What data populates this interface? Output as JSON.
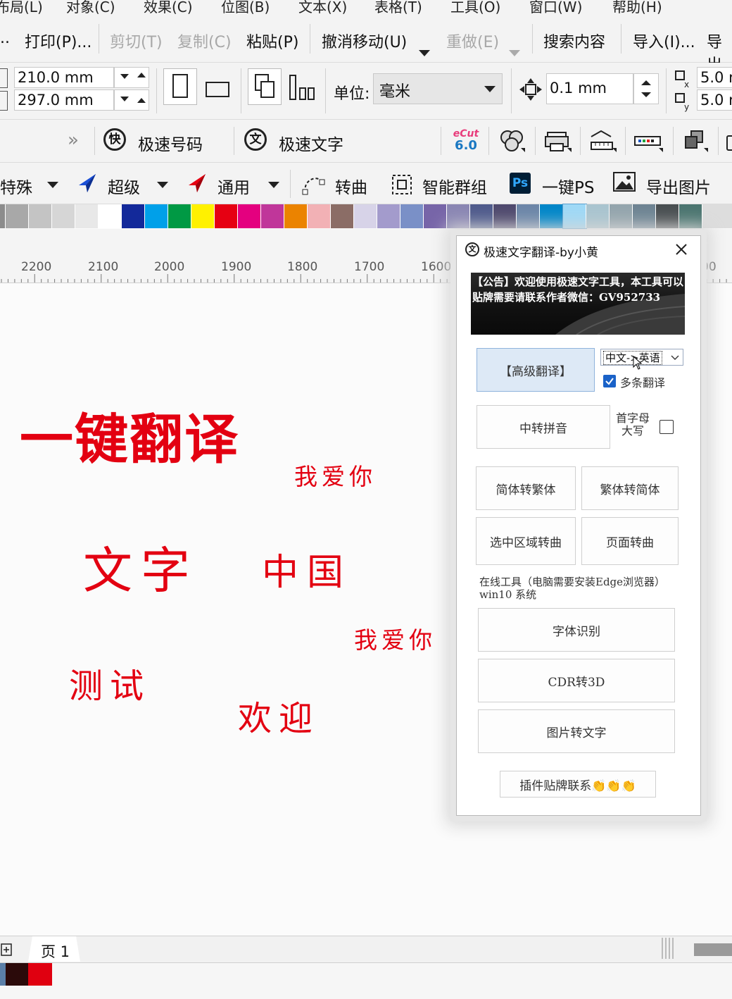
{
  "menu": [
    "布局(L)",
    "对象(C)",
    "效果(C)",
    "位图(B)",
    "文本(X)",
    "表格(T)",
    "工具(O)",
    "窗口(W)",
    "帮助(H)"
  ],
  "toolbar1": {
    "ellipsis": "..",
    "print": "打印(P)...",
    "cut": "剪切(T)",
    "copy": "复制(C)",
    "paste": "粘贴(P)",
    "undo": "撤消移动(U)",
    "redo": "重做(E)",
    "search": "搜索内容",
    "import": "导入(I)...",
    "export": "导出"
  },
  "toolbar2": {
    "width_value": "210.0 mm",
    "height_value": "297.0 mm",
    "unit_label": "单位:",
    "unit_value": "毫米",
    "nudge_value": "0.1 mm",
    "dup_x": "5.0 r",
    "dup_y": "5.0 r"
  },
  "toolbar3": {
    "chevron": "»",
    "fast_number_label": "极速号码",
    "fast_number_icon": "快",
    "fast_text_label": "极速文字",
    "fast_text_icon": "文",
    "ecut_top": "eCut",
    "ecut_bottom": "6.0"
  },
  "toolbar4": {
    "special": "特殊",
    "super": "超级",
    "general": "通用",
    "to_curve": "转曲",
    "smart_group": "智能群组",
    "ps_icon": "Ps",
    "one_key_ps": "一键PS",
    "export_image": "导出图片"
  },
  "palette": [
    "#8c8c8c",
    "#a8a8a8",
    "#c4c4c4",
    "#d6d6d6",
    "#e8e8e8",
    "#ffffff",
    "#13299a",
    "#00a0e9",
    "#009944",
    "#fff100",
    "#e60012",
    "#e4007f",
    "#c0369a",
    "#eb8300",
    "#f2b1b5",
    "#8b6d66",
    "#d7d3e8",
    "#a39bcc",
    "#7a90c7",
    "#7765a8",
    "#8a86b3",
    "#4f5b8c",
    "#4f4a6e",
    "#6c86a8",
    "#0086c8",
    "#9fd9f6",
    "#a9c4cf",
    "#94a5ad",
    "#6e8493",
    "#4a4f52",
    "#4b7570"
  ],
  "ruler": [
    "2200",
    "2100",
    "2000",
    "1900",
    "1800",
    "1700",
    "1600",
    "00"
  ],
  "canvas_texts": {
    "headline": "一键翻译",
    "t1": "我爱你",
    "t2": "文字",
    "t3": "中国",
    "t4": "我爱你",
    "t5": "测试",
    "t6": "欢迎"
  },
  "dialog": {
    "title": "极速文字翻译-by小黄",
    "banner": "【公告】欢迎使用极速文字工具，本工具可以贴牌需要请联系作者微信：GV952733",
    "advanced_translate": "【高级翻译】",
    "lang_select": "中文->英语",
    "multi_translate": "多条翻译",
    "pinyin": "中转拼音",
    "capitalize": "首字母大写",
    "simp_to_trad": "简体转繁体",
    "trad_to_simp": "繁体转简体",
    "sel_to_curve": "选中区域转曲",
    "page_to_curve": "页面转曲",
    "online_note": "在线工具（电脑需要安装Edge浏览器）win10 系统",
    "font_recog": "字体识别",
    "cdr_3d": "CDR转3D",
    "img_to_text": "图片转文字",
    "plugin_brand": "插件贴牌联系👏👏👏"
  },
  "page_tab": "页 1",
  "status_colors": [
    "#5b7fa8",
    "#2b0a0a",
    "#e00010"
  ]
}
